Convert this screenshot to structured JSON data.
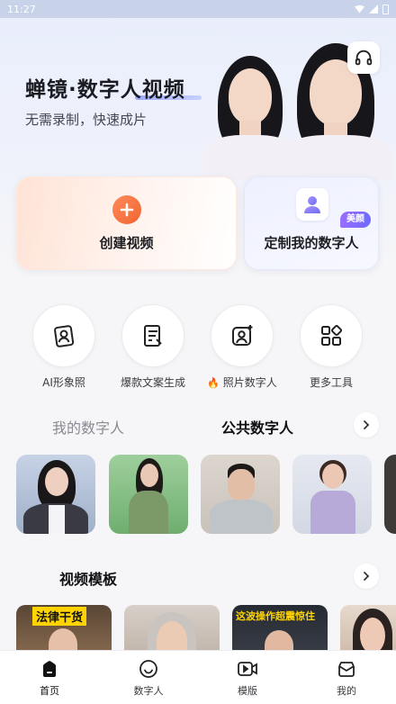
{
  "status_bar": {
    "time": "11:27"
  },
  "hero": {
    "title": "蝉镜·数字人视频",
    "subtitle": "无需录制，快速成片"
  },
  "cards": {
    "create_label": "创建视频",
    "custom_label": "定制我的数字人",
    "custom_badge": "美颜"
  },
  "tools": [
    {
      "label": "AI形象照",
      "icon": "portrait-card-icon"
    },
    {
      "label": "爆款文案生成",
      "icon": "document-pen-icon"
    },
    {
      "label": "照片数字人",
      "prefix": "🔥",
      "icon": "photo-sparkle-icon"
    },
    {
      "label": "更多工具",
      "icon": "grid-shapes-icon"
    }
  ],
  "avatar_tabs": {
    "my": "我的数字人",
    "public": "公共数字人",
    "active": "public"
  },
  "templates": {
    "title": "视频模板",
    "items": [
      {
        "caption": "法律干货"
      },
      {
        "caption": ""
      },
      {
        "caption": "这波操作超震惊住"
      },
      {
        "caption": ""
      }
    ]
  },
  "bottom_nav": [
    {
      "label": "首页",
      "icon": "home-icon",
      "active": true
    },
    {
      "label": "数字人",
      "icon": "smile-face-icon",
      "active": false
    },
    {
      "label": "模版",
      "icon": "video-play-icon",
      "active": false
    },
    {
      "label": "我的",
      "icon": "profile-envelope-icon",
      "active": false
    }
  ],
  "colors": {
    "accent_orange": "#f0652f",
    "accent_purple": "#7b6bff",
    "text_primary": "#111114",
    "text_muted": "#8a8a92"
  }
}
